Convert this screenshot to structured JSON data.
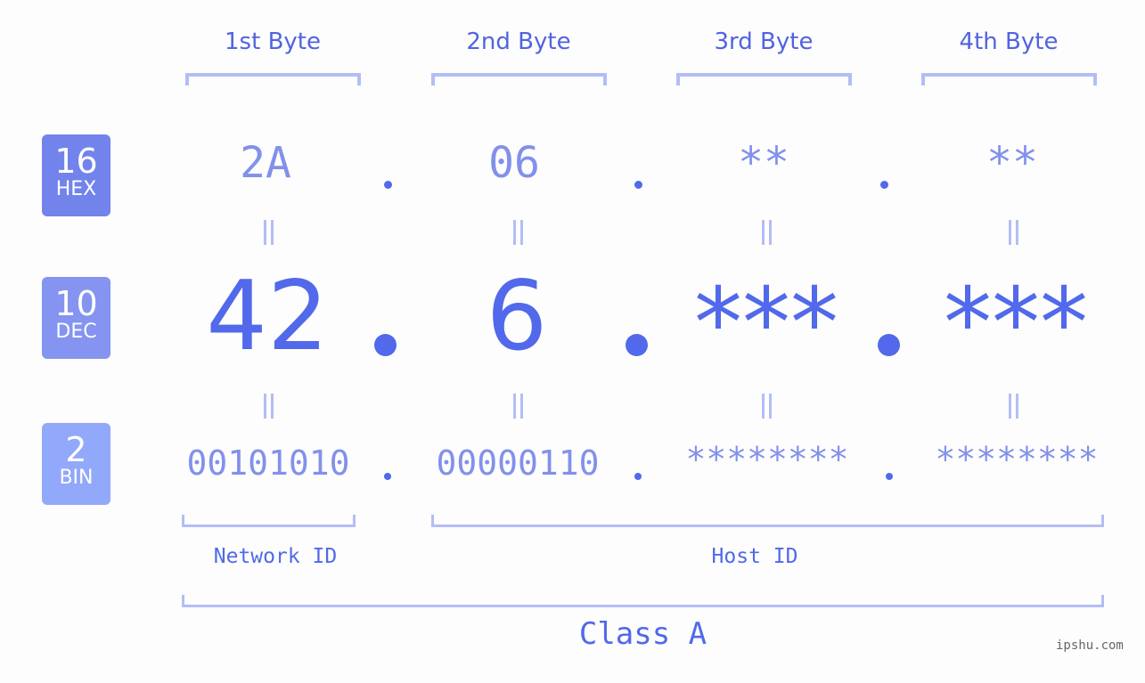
{
  "bytes": {
    "headers": [
      "1st Byte",
      "2nd Byte",
      "3rd Byte",
      "4th Byte"
    ]
  },
  "badges": {
    "hex": {
      "number": "16",
      "label": "HEX",
      "color": "#7283ec"
    },
    "dec": {
      "number": "10",
      "label": "DEC",
      "color": "#8494f0"
    },
    "bin": {
      "number": "2",
      "label": "BIN",
      "color": "#91a8fb"
    }
  },
  "hex": [
    "2A",
    "06",
    "**",
    "**"
  ],
  "dec": [
    "42",
    "6",
    "***",
    "***"
  ],
  "bin": [
    "00101010",
    "00000110",
    "********",
    "********"
  ],
  "separator": ".",
  "ids": {
    "network": "Network ID",
    "host": "Host ID"
  },
  "ip_class": "Class A",
  "watermark": "ipshu.com",
  "colors": {
    "accent": "#5169ea",
    "light_accent": "#8290ec",
    "bracket": "#b3bdf6"
  }
}
